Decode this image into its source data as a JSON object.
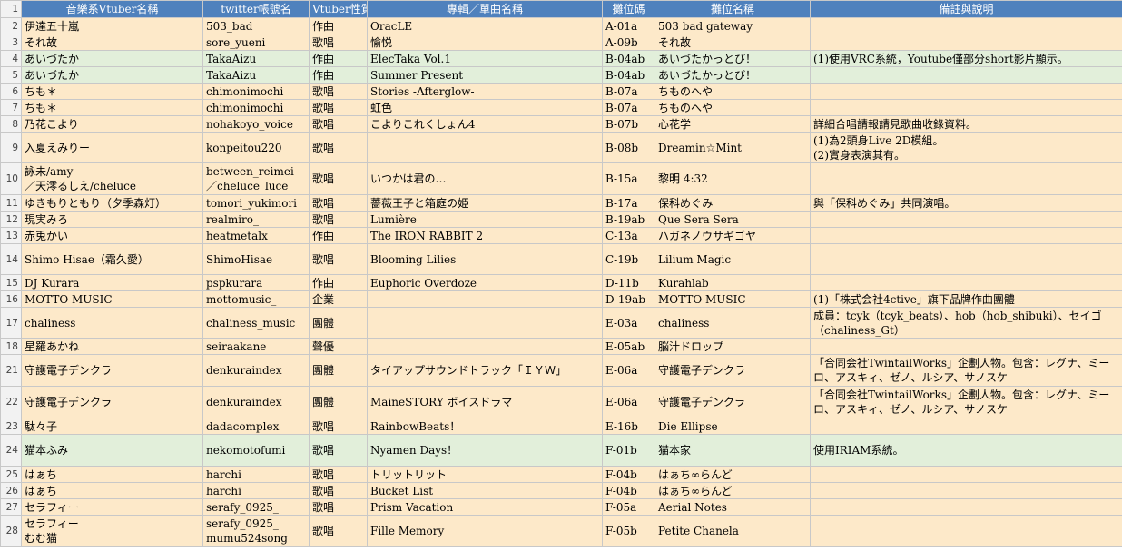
{
  "headers": [
    "音樂系Vtuber名稱",
    "twitter帳號名",
    "Vtuber性質",
    "專輯／單曲名稱",
    "攤位碼",
    "攤位名稱",
    "備註與說明"
  ],
  "header_row_number": "1",
  "rows": [
    {
      "num": "2",
      "color": "orange",
      "cells": [
        "伊達五十嵐",
        "503_bad",
        "作曲",
        "OracLE",
        "A-01a",
        "503 bad gateway",
        ""
      ]
    },
    {
      "num": "3",
      "color": "orange",
      "cells": [
        "それ故",
        "sore_yueni",
        "歌唱",
        "愉悦",
        "A-09b",
        "それ故",
        ""
      ]
    },
    {
      "num": "4",
      "color": "green",
      "cells": [
        "あいづたか",
        "TakaAizu",
        "作曲",
        "ElecTaka Vol.1",
        "B-04ab",
        "あいづたかっとび！",
        "(1)使用VRC系統，Youtube僅部分short影片顯示。"
      ]
    },
    {
      "num": "5",
      "color": "green",
      "cells": [
        "あいづたか",
        "TakaAizu",
        "作曲",
        "Summer Present",
        "B-04ab",
        "あいづたかっとび！",
        ""
      ]
    },
    {
      "num": "6",
      "color": "orange",
      "cells": [
        "ちも＊",
        "chimonimochi",
        "歌唱",
        "Stories -Afterglow-",
        "B-07a",
        "ちものへや",
        ""
      ]
    },
    {
      "num": "7",
      "color": "orange",
      "cells": [
        "ちも＊",
        "chimonimochi",
        "歌唱",
        "虹色",
        "B-07a",
        "ちものへや",
        ""
      ]
    },
    {
      "num": "8",
      "color": "orange",
      "cells": [
        "乃花こより",
        "nohakoyo_voice",
        "歌唱",
        "こよりこれくしょん4",
        "B-07b",
        "心花学",
        "詳細合唱請報請見歌曲收錄資料。"
      ]
    },
    {
      "num": "9",
      "color": "orange",
      "cells": [
        "入夏えみりー",
        "konpeitou220",
        "歌唱",
        "",
        "B-08b",
        "Dreamin☆Mint",
        "(1)為2頭身Live 2D模組。\n(2)實身表演其有。"
      ]
    },
    {
      "num": "10",
      "color": "orange",
      "cells": [
        "詠未/amy\n／天澪るしえ/cheluce",
        "between_reimei\n／cheluce_luce",
        "歌唱",
        "いつかは君の…",
        "B-15a",
        "黎明 4:32",
        ""
      ]
    },
    {
      "num": "11",
      "color": "orange",
      "cells": [
        "ゆきもりともり（夕季森灯）",
        "tomori_yukimori",
        "歌唱",
        "薔薇王子と箱庭の姫",
        "B-17a",
        "保科めぐみ",
        "與「保科めぐみ」共同演唱。"
      ]
    },
    {
      "num": "12",
      "color": "orange",
      "cells": [
        "現実みろ",
        "realmiro_",
        "歌唱",
        "Lumière",
        "B-19ab",
        "Que Sera Sera",
        ""
      ]
    },
    {
      "num": "13",
      "color": "orange",
      "cells": [
        "赤兎かい",
        "heatmetalx",
        "作曲",
        "The IRON RABBIT 2",
        "C-13a",
        "ハガネノウサギゴヤ",
        ""
      ]
    },
    {
      "num": "14",
      "color": "orange",
      "cells": [
        "Shimo Hisae（霜久愛）",
        "ShimoHisae",
        "歌唱",
        "Blooming Lilies",
        "C-19b",
        "Lilium Magic",
        ""
      ]
    },
    {
      "num": "15",
      "color": "orange",
      "cells": [
        "DJ Kurara",
        "pspkurara",
        "作曲",
        "Euphoric Overdoze",
        "D-11b",
        "Kurahlab",
        ""
      ]
    },
    {
      "num": "16",
      "color": "orange",
      "cells": [
        "MOTTO MUSIC",
        "mottomusic_",
        "企業",
        "",
        "D-19ab",
        "MOTTO MUSIC",
        "(1)「株式会社4ctive」旗下品牌作曲團體"
      ]
    },
    {
      "num": "17",
      "color": "orange",
      "cells": [
        "chaliness",
        "chaliness_music",
        "團體",
        "",
        "E-03a",
        "chaliness",
        "成員：tcyk（tcyk_beats）、hob（hob_shibuki）、セイゴ（chaliness_Gt）"
      ]
    },
    {
      "num": "18",
      "color": "orange",
      "cells": [
        "星羅あかね",
        "seiraakane",
        "聲優",
        "",
        "E-05ab",
        "脳汁ドロップ",
        ""
      ]
    },
    {
      "num": "21",
      "color": "orange",
      "cells": [
        "守護電子デンクラ",
        "denkuraindex",
        "團體",
        "タイアップサウンドトラック「ＩＹＷ」",
        "E-06a",
        "守護電子デンクラ",
        "「合同会社TwintailWorks」企劃人物。包含：レグナ、ミーロ、アスキィ、ゼノ、ルシア、サノスケ"
      ]
    },
    {
      "num": "22",
      "color": "orange",
      "cells": [
        "守護電子デンクラ",
        "denkuraindex",
        "團體",
        "MaineSTORY ボイスドラマ",
        "E-06a",
        "守護電子デンクラ",
        "「合同会社TwintailWorks」企劃人物。包含：レグナ、ミーロ、アスキィ、ゼノ、ルシア、サノスケ"
      ]
    },
    {
      "num": "23",
      "color": "orange",
      "cells": [
        "駄々子",
        "dadacomplex",
        "歌唱",
        "RainbowBeats！",
        "E-16b",
        "Die Ellipse",
        ""
      ]
    },
    {
      "num": "24",
      "color": "green",
      "cells": [
        "猫本ふみ",
        "nekomotofumi",
        "歌唱",
        "Nyamen Days！",
        "F-01b",
        "猫本家",
        "使用IRIAM系統。"
      ]
    },
    {
      "num": "25",
      "color": "orange",
      "cells": [
        "はぁち",
        "harchi",
        "歌唱",
        "トリットリット",
        "F-04b",
        "はぁち∞らんど",
        ""
      ]
    },
    {
      "num": "26",
      "color": "orange",
      "cells": [
        "はぁち",
        "harchi",
        "歌唱",
        "Bucket List",
        "F-04b",
        "はぁち∞らんど",
        ""
      ]
    },
    {
      "num": "27",
      "color": "orange",
      "cells": [
        "セラフィー",
        "serafy_0925_",
        "歌唱",
        "Prism Vacation",
        "F-05a",
        "Aerial Notes",
        ""
      ]
    },
    {
      "num": "28",
      "color": "orange",
      "cells": [
        "セラフィー\nむむ猫",
        "serafy_0925_\nmumu524song",
        "歌唱",
        "Fille Memory",
        "F-05b",
        "Petite Chanela",
        ""
      ]
    }
  ]
}
